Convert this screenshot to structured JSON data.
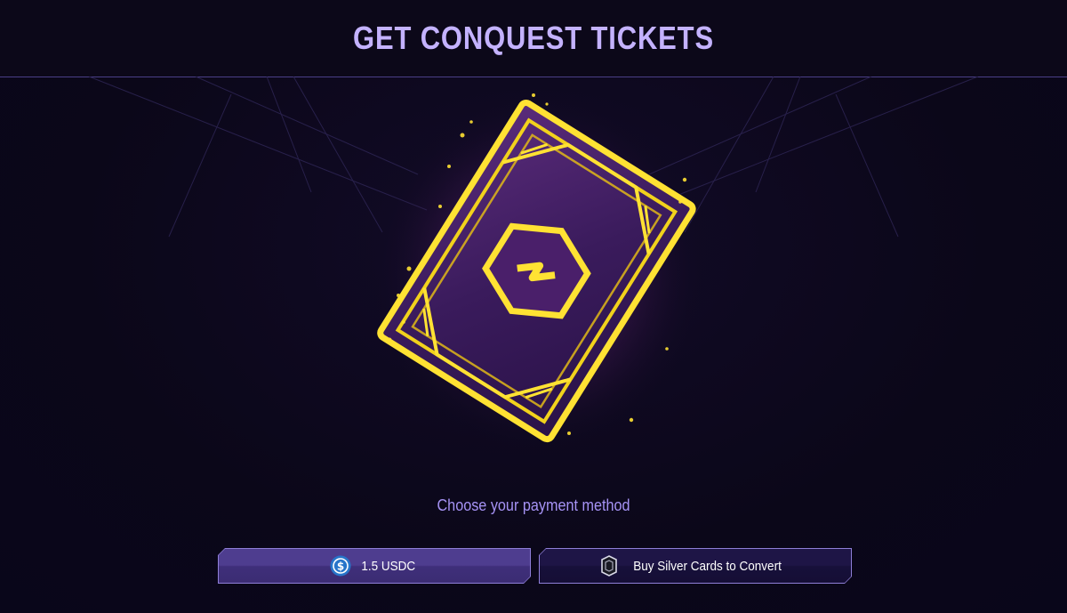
{
  "header": {
    "title": "GET CONQUEST TICKETS"
  },
  "hero": {
    "icon": "conquest-ticket-card-icon",
    "glow_color": "#ffe233",
    "card_color": "#3a1b5c"
  },
  "payment": {
    "prompt": "Choose your payment method",
    "options": [
      {
        "label": "1.5 USDC",
        "icon": "usdc-coin-icon"
      },
      {
        "label": "Buy Silver Cards to Convert",
        "icon": "silver-card-icon"
      }
    ]
  },
  "colors": {
    "background": "#0b0719",
    "accent": "#c4b2ff",
    "prompt": "#a693f5",
    "usdc_blue": "#2775ca"
  }
}
